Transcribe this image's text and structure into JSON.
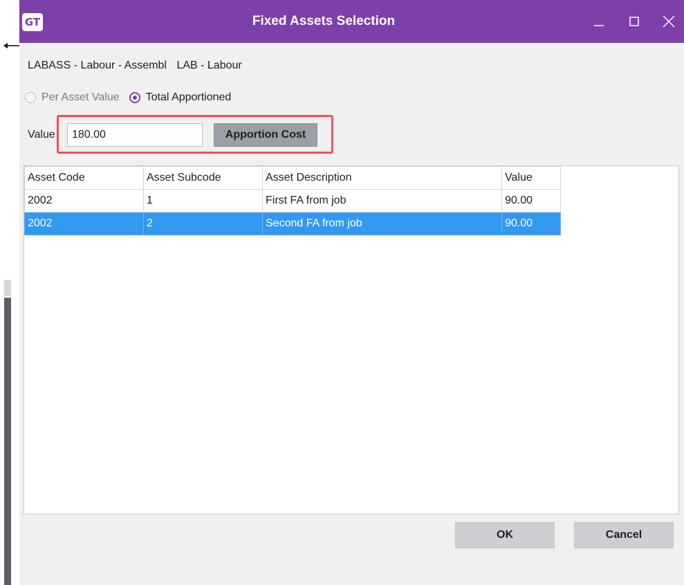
{
  "window": {
    "logo_text": "GT",
    "title": "Fixed Assets Selection",
    "accent_color": "#7d3fa8"
  },
  "item_codes": {
    "item": "LABASS - Labour - Assembl",
    "category": "LAB - Labour"
  },
  "apportion_mode": {
    "options": [
      {
        "label": "Per Asset Value",
        "selected": false,
        "enabled": false
      },
      {
        "label": "Total Apportioned",
        "selected": true,
        "enabled": true
      }
    ]
  },
  "value_field": {
    "label": "Value",
    "value": "180.00"
  },
  "apportion_button": {
    "label": "Apportion Cost"
  },
  "asset_table": {
    "columns": [
      "Asset Code",
      "Asset Subcode",
      "Asset Description",
      "Value"
    ],
    "rows": [
      {
        "code": "2002",
        "subcode": "1",
        "description": "First FA from job",
        "value": "90.00",
        "selected": false
      },
      {
        "code": "2002",
        "subcode": "2",
        "description": "Second FA from job",
        "value": "90.00",
        "selected": true
      }
    ],
    "selection_color": "#3399ee"
  },
  "footer": {
    "ok_label": "OK",
    "cancel_label": "Cancel"
  },
  "highlight_color": "#e8545a"
}
